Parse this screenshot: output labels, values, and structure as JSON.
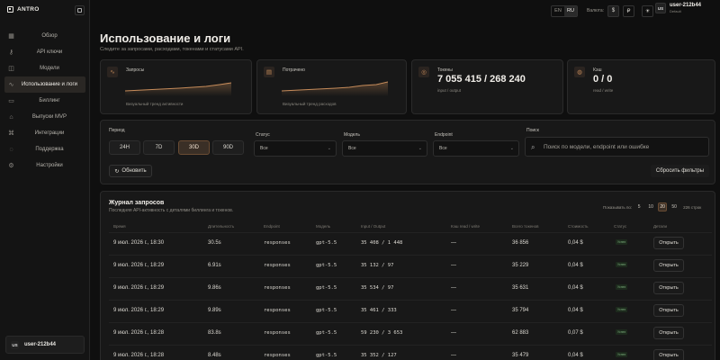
{
  "brand": {
    "name": "ANTRO"
  },
  "sidebar": {
    "items": [
      {
        "label": "Обзор",
        "icon": "grid-icon"
      },
      {
        "label": "API ключи",
        "icon": "key-icon"
      },
      {
        "label": "Модели",
        "icon": "cube-icon"
      },
      {
        "label": "Использование и логи",
        "icon": "activity-icon",
        "active": true
      },
      {
        "label": "Биллинг",
        "icon": "card-icon"
      },
      {
        "label": "Выпуски MVP",
        "icon": "rocket-icon"
      },
      {
        "label": "Интеграции",
        "icon": "plug-icon"
      },
      {
        "label": "Поддержка",
        "icon": "chat-icon"
      },
      {
        "label": "Настройки",
        "icon": "gear-icon"
      }
    ],
    "user": {
      "initials": "US",
      "name": "user-212b44"
    }
  },
  "topbar": {
    "langs": [
      "EN",
      "RU"
    ],
    "active_lang": "RU",
    "currency_label": "Валюта:",
    "currencies": [
      "$",
      "₽"
    ],
    "user_initials": "US",
    "user_name": "user-212b44",
    "user_sub": "Default"
  },
  "page": {
    "title": "Использование и логи",
    "subtitle": "Следите за запросами, расходами, токенами и статусами API."
  },
  "stats": {
    "requests": {
      "label": "Запросы",
      "foot": "Визуальный тренд активности"
    },
    "spent": {
      "label": "Потрачено",
      "foot": "Визуальный тренд расходов"
    },
    "tokens": {
      "label": "Токены",
      "value": "7 055 415 / 268 240",
      "sub": "input / output"
    },
    "cache": {
      "label": "Кэш",
      "value": "0 / 0",
      "sub": "read / write"
    }
  },
  "filters": {
    "period_label": "Период",
    "periods": [
      "24H",
      "7D",
      "30D",
      "90D"
    ],
    "active_period": "30D",
    "status_label": "Статус",
    "status_value": "Все",
    "model_label": "Модель",
    "model_value": "Все",
    "endpoint_label": "Endpoint",
    "endpoint_value": "Все",
    "search_label": "Поиск",
    "search_placeholder": "Поиск по модели, endpoint или ошибке",
    "refresh_label": "Обновить",
    "reset_label": "Сбросить фильтры"
  },
  "log": {
    "title": "Журнал запросов",
    "subtitle": "Последняя API-активность с деталями биллинга и токенов.",
    "show_label": "Показывать по:",
    "page_sizes": [
      "5",
      "10",
      "20",
      "50"
    ],
    "active_page_size": "20",
    "total_label": "226 строк",
    "columns": [
      "Время",
      "Длительность",
      "Endpoint",
      "Модель",
      "Input / Output",
      "Кэш read / write",
      "Всего токенов",
      "Стоимость",
      "Статус",
      "Детали"
    ],
    "open_label": "Открыть",
    "rows": [
      {
        "time": "9 июл. 2026 г., 18:30",
        "duration": "30.5s",
        "endpoint": "responses",
        "model": "gpt-5.5",
        "io": "35 408 / 1 448",
        "cache": "—",
        "total": "36 856",
        "cost": "0,04 $",
        "status": "Успех"
      },
      {
        "time": "9 июл. 2026 г., 18:29",
        "duration": "6.91s",
        "endpoint": "responses",
        "model": "gpt-5.5",
        "io": "35 132 / 97",
        "cache": "—",
        "total": "35 229",
        "cost": "0,04 $",
        "status": "Успех"
      },
      {
        "time": "9 июл. 2026 г., 18:29",
        "duration": "9.86s",
        "endpoint": "responses",
        "model": "gpt-5.5",
        "io": "35 534 / 97",
        "cache": "—",
        "total": "35 631",
        "cost": "0,04 $",
        "status": "Успех"
      },
      {
        "time": "9 июл. 2026 г., 18:29",
        "duration": "9.89s",
        "endpoint": "responses",
        "model": "gpt-5.5",
        "io": "35 461 / 333",
        "cache": "—",
        "total": "35 794",
        "cost": "0,04 $",
        "status": "Успех"
      },
      {
        "time": "9 июл. 2026 г., 18:28",
        "duration": "83.8s",
        "endpoint": "responses",
        "model": "gpt-5.5",
        "io": "59 230 / 3 653",
        "cache": "—",
        "total": "62 883",
        "cost": "0,07 $",
        "status": "Успех"
      },
      {
        "time": "9 июл. 2026 г., 18:28",
        "duration": "8.48s",
        "endpoint": "responses",
        "model": "gpt-5.5",
        "io": "35 352 / 127",
        "cache": "—",
        "total": "35 479",
        "cost": "0,04 $",
        "status": "Успех"
      }
    ]
  },
  "colors": {
    "accent": "#c58b5a",
    "bg": "#0f0f0f",
    "card": "#181818"
  }
}
